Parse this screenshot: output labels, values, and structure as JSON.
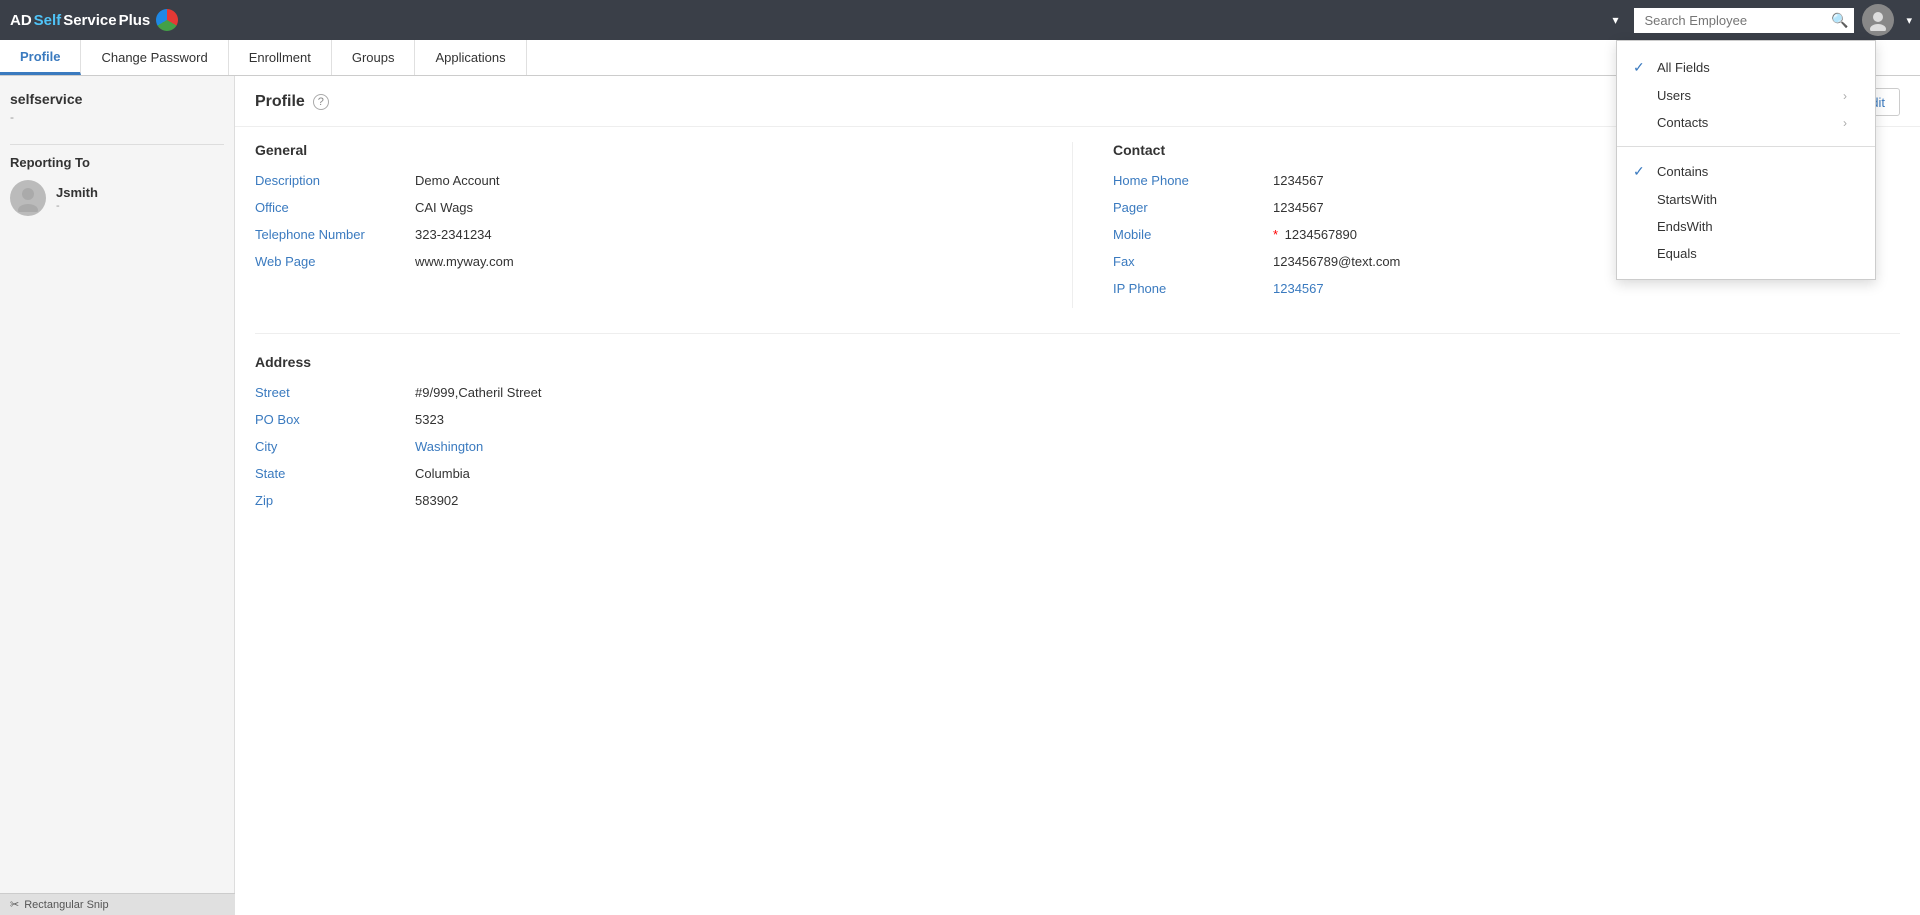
{
  "app": {
    "logo_text": "ADSelfService Plus",
    "logo_parts": {
      "ad": "AD",
      "self": "Self",
      "service": "Service",
      "plus": " Plus"
    }
  },
  "nav": {
    "search_placeholder": "Search Employee",
    "dropdown_triangle": "▾"
  },
  "tabs": [
    {
      "id": "profile",
      "label": "Profile",
      "active": true
    },
    {
      "id": "change-password",
      "label": "Change Password",
      "active": false
    },
    {
      "id": "enrollment",
      "label": "Enrollment",
      "active": false
    },
    {
      "id": "groups",
      "label": "Groups",
      "active": false
    },
    {
      "id": "applications",
      "label": "Applications",
      "active": false
    }
  ],
  "sidebar": {
    "username": "selfservice",
    "dash": "-",
    "reporting_to_label": "Reporting To",
    "reporting_person": {
      "name": "Jsmith",
      "sub": "-"
    }
  },
  "profile": {
    "title": "Profile",
    "edit_label": "Edit",
    "general": {
      "section_title": "General",
      "fields": [
        {
          "label": "Description",
          "value": "Demo Account",
          "type": "normal"
        },
        {
          "label": "Office",
          "value": "CAI Wags",
          "type": "normal"
        },
        {
          "label": "Telephone Number",
          "value": "323-2341234",
          "type": "normal"
        },
        {
          "label": "Web Page",
          "value": "www.myway.com",
          "type": "normal"
        }
      ]
    },
    "contact": {
      "section_title": "Contact",
      "fields": [
        {
          "label": "Home Phone",
          "value": "1234567",
          "required": false,
          "type": "normal"
        },
        {
          "label": "Pager",
          "value": "1234567",
          "required": false,
          "type": "normal"
        },
        {
          "label": "Mobile",
          "value": "1234567890",
          "required": true,
          "type": "normal"
        },
        {
          "label": "Fax",
          "value": "123456789@text.com",
          "required": false,
          "type": "normal"
        },
        {
          "label": "IP Phone",
          "value": "1234567",
          "required": false,
          "type": "link"
        }
      ]
    },
    "address": {
      "section_title": "Address",
      "fields": [
        {
          "label": "Street",
          "value": "#9/999,Catheril Street",
          "type": "normal"
        },
        {
          "label": "PO Box",
          "value": "5323",
          "type": "normal"
        },
        {
          "label": "City",
          "value": "Washington",
          "type": "link"
        },
        {
          "label": "State",
          "value": "Columbia",
          "type": "normal"
        },
        {
          "label": "Zip",
          "value": "583902",
          "type": "normal"
        }
      ]
    }
  },
  "search_dropdown": {
    "visible": true,
    "field_options": [
      {
        "label": "All Fields",
        "checked": true,
        "has_sub": false
      },
      {
        "label": "Users",
        "checked": false,
        "has_sub": true
      },
      {
        "label": "Contacts",
        "checked": false,
        "has_sub": true
      }
    ],
    "filter_options": [
      {
        "label": "Contains",
        "checked": true
      },
      {
        "label": "StartsWith",
        "checked": false
      },
      {
        "label": "EndsWith",
        "checked": false
      },
      {
        "label": "Equals",
        "checked": false
      }
    ]
  },
  "snip_bar": {
    "label": "Rectangular Snip"
  }
}
